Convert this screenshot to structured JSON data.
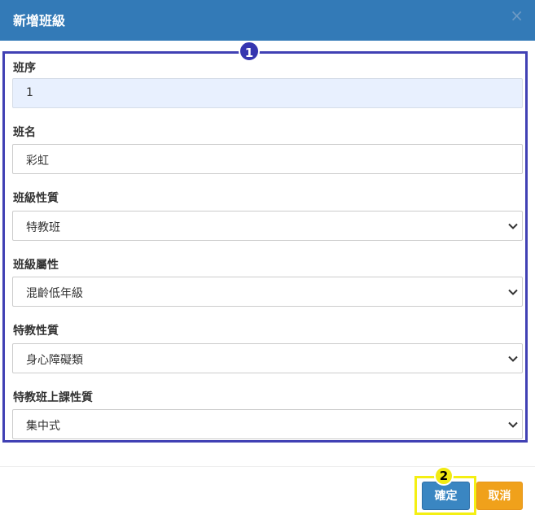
{
  "dialog": {
    "title": "新增班級",
    "close_glyph": "×"
  },
  "form": {
    "fields": [
      {
        "label": "班序",
        "value": "1",
        "type": "readonly"
      },
      {
        "label": "班名",
        "value": "彩虹",
        "type": "text"
      },
      {
        "label": "班級性質",
        "value": "特教班",
        "type": "select"
      },
      {
        "label": "班級屬性",
        "value": "混齡低年級",
        "type": "select"
      },
      {
        "label": "特教性質",
        "value": "身心障礙類",
        "type": "select"
      },
      {
        "label": "特教班上課性質",
        "value": "集中式",
        "type": "select"
      }
    ]
  },
  "annotations": {
    "badge1": "1",
    "badge2": "2",
    "frame_color": "#4141b4",
    "highlight_color": "#f4ef13"
  },
  "footer": {
    "ok_label": "確定",
    "cancel_label": "取消"
  },
  "colors": {
    "header": "#337ab7",
    "ok": "#3a86c2",
    "cancel": "#f0a11b",
    "readonly_bg": "#e8f0fe"
  }
}
